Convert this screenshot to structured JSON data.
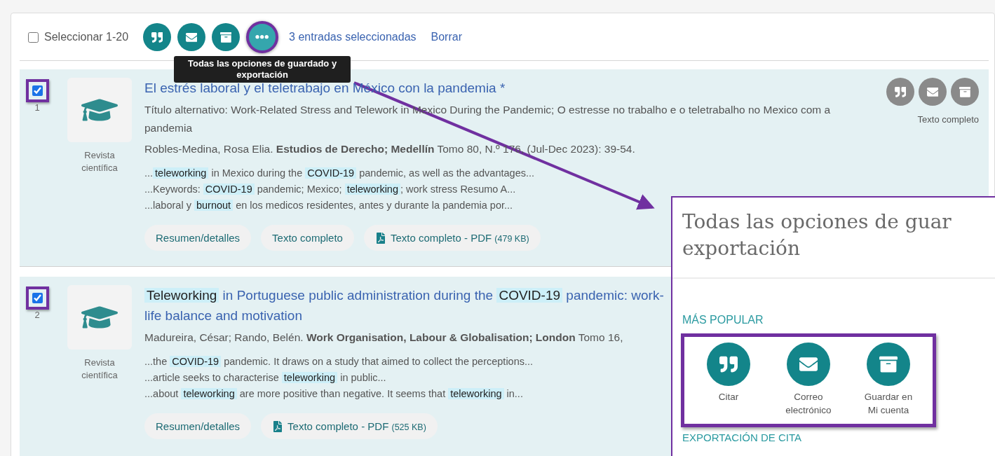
{
  "toolbar": {
    "select_all": {
      "label": "Seleccionar 1-20",
      "checked": false
    },
    "actions": [
      {
        "kind": "cite",
        "annotated": false
      },
      {
        "kind": "email",
        "annotated": false
      },
      {
        "kind": "save",
        "annotated": false
      },
      {
        "kind": "more",
        "annotated": true
      }
    ],
    "selected_count": "3 entradas seleccionadas",
    "clear": "Borrar"
  },
  "tooltip": "Todas las opciones de guardado y exportación",
  "records": [
    {
      "number": "1",
      "checked": true,
      "annotated": true,
      "type": "Revista científica",
      "title": [
        {
          "text": "El estrés laboral y el teletrabajo en México con la pandemia *",
          "highlight": false
        }
      ],
      "alt_title": "Título alternativo: Work-Related Stress and Telework in Mexico During the Pandemic; O estresse no trabalho e o teletrabalho no Mexico com a pandemia",
      "source": "Robles-Medina, Rosa Elia.  **Estudios de Derecho; Medellín** Tomo 80, N.º 176,  (Jul-Dec 2023): 39-54.",
      "snippets": [
        [
          {
            "text": "...",
            "highlight": false
          },
          {
            "text": "teleworking",
            "highlight": true
          },
          {
            "text": " in Mexico during the ",
            "highlight": false
          },
          {
            "text": "COVID-19",
            "highlight": true
          },
          {
            "text": " pandemic, as well as the advantages...",
            "highlight": false
          }
        ],
        [
          {
            "text": "...Keywords: ",
            "highlight": false
          },
          {
            "text": "COVID-19",
            "highlight": true
          },
          {
            "text": " pandemic; Mexico; ",
            "highlight": false
          },
          {
            "text": "teleworking",
            "highlight": true
          },
          {
            "text": "; work stress Resumo A...",
            "highlight": false
          }
        ],
        [
          {
            "text": "...laboral y ",
            "highlight": false
          },
          {
            "text": "burnout",
            "highlight": true
          },
          {
            "text": " en los medicos residentes, antes y durante la pandemia por...",
            "highlight": false
          }
        ]
      ],
      "links": [
        {
          "kind": "plain",
          "label": "Resumen/detalles"
        },
        {
          "kind": "plain",
          "label": "Texto completo"
        },
        {
          "kind": "pdf",
          "label": "Texto completo - PDF",
          "size": "(479 KB)"
        }
      ],
      "side": {
        "actions": [
          {
            "kind": "cite"
          },
          {
            "kind": "email"
          },
          {
            "kind": "save"
          }
        ],
        "note": "Texto completo"
      }
    },
    {
      "number": "2",
      "checked": true,
      "annotated": true,
      "type": "Revista científica",
      "title": [
        {
          "text": "Teleworking",
          "highlight": true
        },
        {
          "text": " in Portuguese public administration during the ",
          "highlight": false
        },
        {
          "text": "COVID-19",
          "highlight": true
        },
        {
          "text": " pandemic:",
          "highlight": false
        },
        {
          "text": " work-life balance and motivation",
          "highlight": false
        }
      ],
      "source": "Madureira, César; Rando, Belén.  **Work Organisation, Labour & Globalisation; London** Tomo 16,",
      "snippets": [
        [
          {
            "text": "...the ",
            "highlight": false
          },
          {
            "text": "COVID-19",
            "highlight": true
          },
          {
            "text": " pandemic. It draws on a study that aimed to collect the perceptions...",
            "highlight": false
          }
        ],
        [
          {
            "text": "...article seeks to characterise ",
            "highlight": false
          },
          {
            "text": "teleworking",
            "highlight": true
          },
          {
            "text": " in public...",
            "highlight": false
          }
        ],
        [
          {
            "text": "...about ",
            "highlight": false
          },
          {
            "text": "teleworking",
            "highlight": true
          },
          {
            "text": " are more positive than negative. It seems that ",
            "highlight": false
          },
          {
            "text": "teleworking",
            "highlight": true
          },
          {
            "text": " in...",
            "highlight": false
          }
        ]
      ],
      "links": [
        {
          "kind": "plain",
          "label": "Resumen/detalles"
        },
        {
          "kind": "pdf",
          "label": "Texto completo - PDF",
          "size": "(525 KB)"
        }
      ]
    }
  ],
  "panel": {
    "title": "Todas las opciones de guar",
    "title_line2": "exportación",
    "section": "MÁS POPULAR",
    "annotated": true,
    "actions": [
      {
        "kind": "cite",
        "label": "Citar"
      },
      {
        "kind": "email",
        "label": "Correo electrónico"
      },
      {
        "kind": "save",
        "label": "Guardar en Mi cuenta"
      }
    ],
    "next_section": "EXPORTACIÓN DE CITA"
  }
}
